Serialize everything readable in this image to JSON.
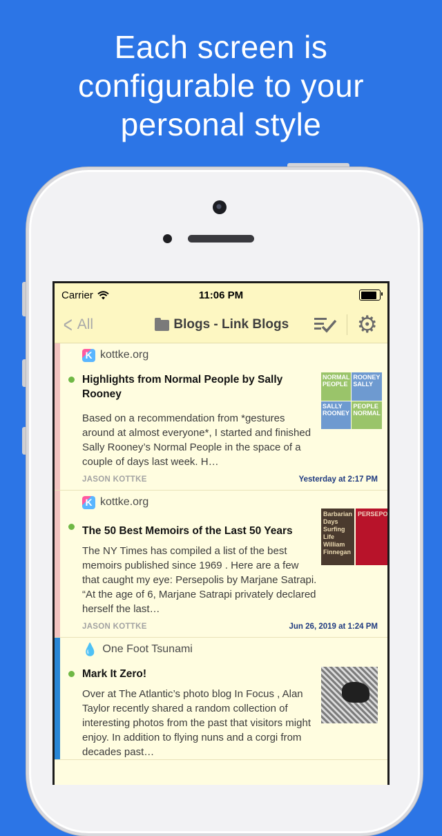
{
  "headline": [
    "Each screen is",
    "configurable to your",
    "personal style"
  ],
  "status": {
    "carrier": "Carrier",
    "time": "11:06 PM"
  },
  "nav": {
    "back": "All",
    "title": "Blogs - Link Blogs"
  },
  "cards": [
    {
      "source": "kottke.org",
      "title": "Highlights from Normal People by Sally Rooney",
      "excerpt": "Based on a recommendation from *gestures around at almost everyone*, I started and finished  Sally Rooney’s Normal People in the space of a couple of days last week. H…",
      "author": "JASON KOTTKE",
      "date": "Yesterday at 2:17 PM",
      "thumb": [
        "NORMAL PEOPLE",
        "ROONEY SALLY",
        "SALLY ROONEY",
        "PEOPLE NORMAL"
      ]
    },
    {
      "source": "kottke.org",
      "title": "The 50 Best Memoirs of the Last 50 Years",
      "excerpt": "The NY Times has compiled  a list of the best memoirs published since 1969 . Here are a few that caught my eye: Persepolis by Marjane Satrapi. “At the age of 6, Marjane Satrapi privately declared herself the last…",
      "author": "JASON KOTTKE",
      "date": "Jun 26, 2019 at 1:24 PM",
      "thumb": [
        "Barbarian Days Surfing Life William Finnegan",
        "PERSEPOLIS"
      ]
    },
    {
      "source": "One Foot Tsunami",
      "title": "Mark It Zero!",
      "excerpt": "Over at The Atlantic’s photo blog  In Focus , Alan Taylor recently shared  a random collection of interesting photos from the past that visitors might enjoy. In addition to flying nuns and a  corgi from decades past…"
    }
  ],
  "colors": {
    "background": "#2c75e6",
    "screen": "#fffde0",
    "unread_dot": "#6fb845",
    "strip_pink": "#f2c3bf",
    "strip_blue": "#2786d6"
  }
}
